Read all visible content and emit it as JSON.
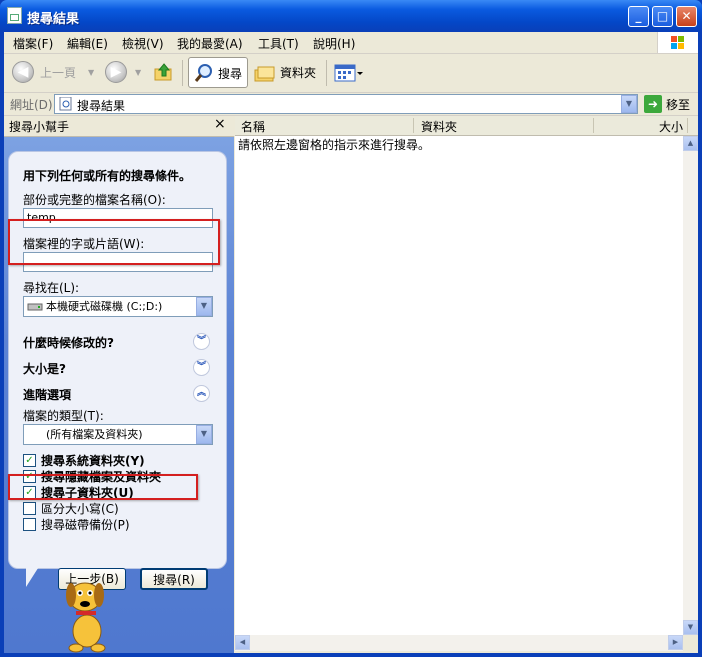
{
  "window": {
    "title": "搜尋結果",
    "min_label": "_",
    "max_label": "□",
    "close_label": "✕"
  },
  "menu": [
    "檔案(F)",
    "編輯(E)",
    "檢視(V)",
    "我的最愛(A)",
    "工具(T)",
    "說明(H)"
  ],
  "toolbar": {
    "back": "上一頁",
    "search": "搜尋",
    "folders": "資料夾"
  },
  "address": {
    "label": "網址(D)",
    "value": "搜尋結果",
    "go": "移至"
  },
  "assistant": {
    "header": "搜尋小幫手",
    "close": "×",
    "heading": "用下列任何或所有的搜尋條件。",
    "name_label": "部份或完整的檔案名稱(O):",
    "name_value": "temp",
    "phrase_label": "檔案裡的字或片語(W):",
    "phrase_value": "",
    "look_in_label": "尋找在(L):",
    "look_in_value": "本機硬式磁碟機 (C:;D:)",
    "when_modified": "什麼時候修改的?",
    "what_size": "大小是?",
    "advanced": "進階選項",
    "type_label": "檔案的類型(T):",
    "type_value": "(所有檔案及資料夾)",
    "options": [
      {
        "label": "搜尋系統資料夾(Y)",
        "checked": true
      },
      {
        "label": "搜尋隱藏檔案及資料夾",
        "checked": true
      },
      {
        "label": "搜尋子資料夾(U)",
        "checked": true
      },
      {
        "label": "區分大小寫(C)",
        "checked": false
      },
      {
        "label": "搜尋磁帶備份(P)",
        "checked": false
      }
    ],
    "back_button": "上一步(B)",
    "search_button": "搜尋(R)"
  },
  "list": {
    "columns": [
      "名稱",
      "資料夾",
      "大小"
    ],
    "message": "請依照左邊窗格的指示來進行搜尋。"
  },
  "colors": {
    "titlebar": "#0a5ae0",
    "pane": "#5b82d4",
    "highlight": "#d41f1f"
  }
}
